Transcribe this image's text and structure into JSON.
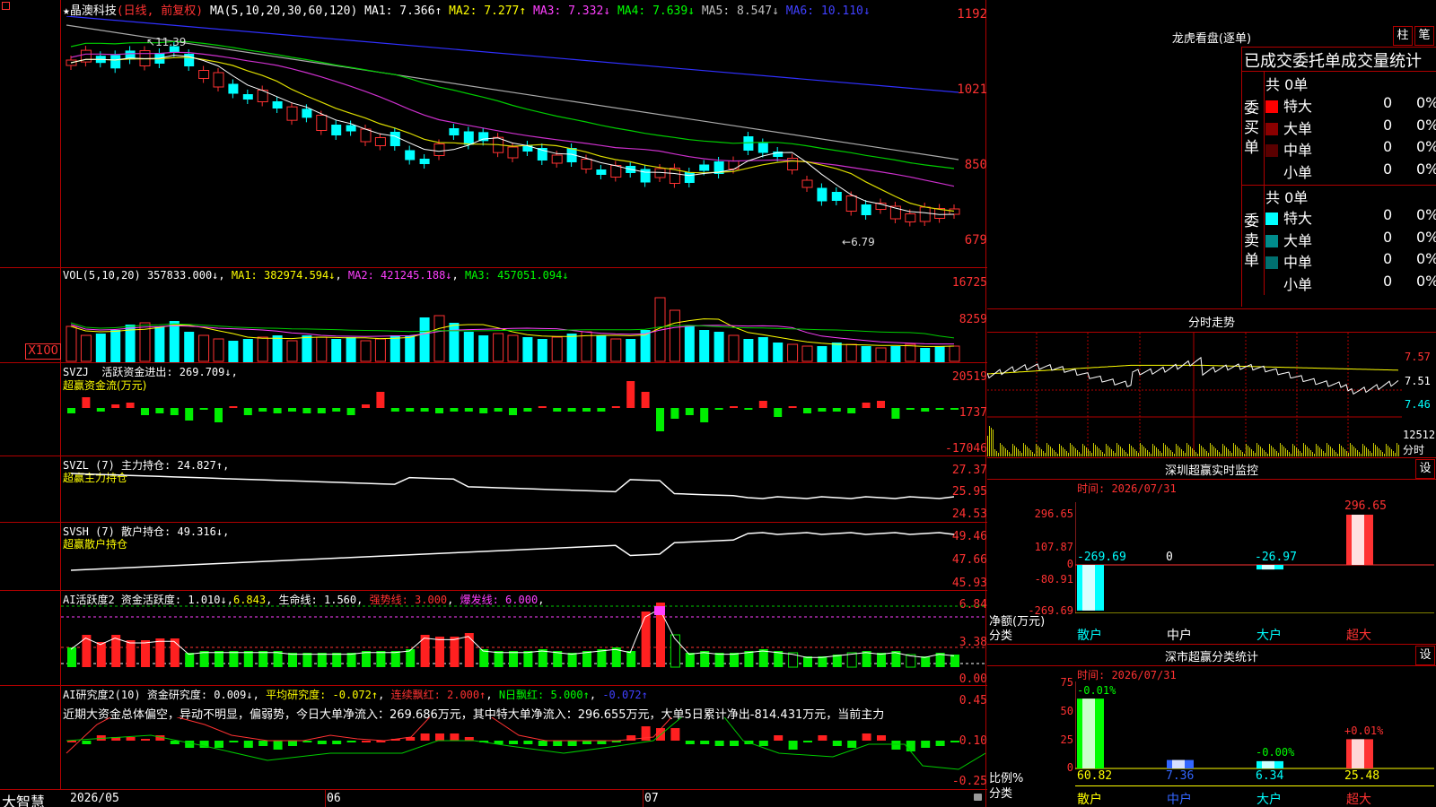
{
  "stock": {
    "title": "★晶澳科技",
    "mode": "(日线, 前复权)",
    "ma_label": "MA(5,10,20,30,60,120)",
    "ma": [
      {
        "label": "MA1: 7.366↑",
        "color": "#ffffff"
      },
      {
        "label": "MA2: 7.277↑",
        "color": "#ffff00"
      },
      {
        "label": "MA3: 7.332↓",
        "color": "#ff40ff"
      },
      {
        "label": "MA4: 7.639↓",
        "color": "#00ff00"
      },
      {
        "label": "MA5: 8.547↓",
        "color": "#c0c0c0"
      },
      {
        "label": "MA6: 10.110↓",
        "color": "#4040ff"
      }
    ],
    "y_ticks": [
      "1192",
      "1021",
      "850",
      "679"
    ],
    "high_mark": "11.39",
    "low_mark": "6.79"
  },
  "vol": {
    "label": "VOL(5,10,20)",
    "value": "357833.000↓",
    "ma1": "MA1: 382974.594↓",
    "ma2": "MA2: 421245.188↓",
    "ma3": "MA3: 457051.094↓",
    "y_ticks": [
      "16725",
      "8259",
      "X100"
    ]
  },
  "svzj": {
    "label": "SVZJ",
    "text": "活跃资金进出: 269.709↓",
    "sub": "超赢资金流(万元)",
    "y_ticks": [
      "20519",
      "1737",
      "-17046"
    ]
  },
  "svzl": {
    "label": "SVZL (7)",
    "text": "主力持仓: 24.827↑",
    "sub": "超赢主力持仓",
    "y_ticks": [
      "27.37",
      "25.95",
      "24.53"
    ]
  },
  "svsh": {
    "label": "SVSH (7)",
    "text": "散户持仓: 49.316↓",
    "sub": "超赢散户持仓",
    "y_ticks": [
      "49.46",
      "47.66",
      "45.93"
    ]
  },
  "ai2": {
    "label": "AI活跃度2",
    "t1": "资金活跃度: 1.010↓",
    "t2": "6.843",
    "t3": "生命线: 1.560",
    "t4": "强势线: 3.000",
    "t5": "爆发线: 6.000",
    "y_ticks": [
      "6.84",
      "3.38",
      "0.00"
    ]
  },
  "ai_res": {
    "label": "AI研究度2(10)",
    "t1": "资金研究度: 0.009↓",
    "t2": "平均研究度: -0.072↑",
    "t3": "连续飘红: 2.000↑",
    "t4": "N日飘红: 5.000↑",
    "t5": "-0.072↑",
    "desc": "近期大资金总体偏空，异动不明显，偏弱势，今日大单净流入：269.686万元，其中特大单净流入：296.655万元，大单5日累计净出-814.431万元，当前主力",
    "y_ticks": [
      "0.45",
      "0.10",
      "-0.25"
    ]
  },
  "footer": {
    "brand": "大智慧",
    "dates": [
      "2026/05",
      "06",
      "07"
    ]
  },
  "lhb": {
    "title": "龙虎看盘(逐单)",
    "btn_zhu": "柱",
    "btn_bi": "笔",
    "tabs": "已成交委托单成交量统计",
    "buy_side": "委买单",
    "sell_side": "委卖单",
    "buy_total": "共 0单",
    "sell_total": "共 0单",
    "buy_rows": [
      {
        "name": "特大",
        "count": "0",
        "pct": "0%",
        "color": "#ff0000"
      },
      {
        "name": "大单",
        "count": "0",
        "pct": "0%",
        "color": "#8b0000"
      },
      {
        "name": "中单",
        "count": "0",
        "pct": "0%",
        "color": "#5a0000"
      },
      {
        "name": "小单",
        "count": "0",
        "pct": "0%",
        "color": "#000000"
      }
    ],
    "sell_rows": [
      {
        "name": "特大",
        "count": "0",
        "pct": "0%",
        "color": "#00ffff"
      },
      {
        "name": "大单",
        "count": "0",
        "pct": "0%",
        "color": "#008b8b"
      },
      {
        "name": "中单",
        "count": "0",
        "pct": "0%",
        "color": "#007070"
      },
      {
        "name": "小单",
        "count": "0",
        "pct": "0%",
        "color": "#000000"
      }
    ]
  },
  "intraday": {
    "title": "分时走势",
    "y_ticks": [
      "7.57",
      "7.51",
      "7.46"
    ],
    "vol_label": "12512",
    "unit": "分时"
  },
  "sz_monitor": {
    "title": "深圳超赢实时监控",
    "set": "设",
    "time": "时间: 2026/07/31",
    "y_ticks": [
      "296.65",
      "107.87",
      "0",
      "-80.91",
      "-269.69"
    ],
    "values": [
      "-269.69",
      "0",
      "-26.97",
      "296.65"
    ],
    "axis_title1": "净额(万元)",
    "axis_title2": "分类",
    "cats": [
      "散户",
      "中户",
      "大户",
      "超大"
    ]
  },
  "sz_stats": {
    "title": "深市超赢分类统计",
    "set": "设",
    "time": "时间: 2026/07/31",
    "y_ticks": [
      "75",
      "50",
      "25",
      "0"
    ],
    "bar_values": [
      "60.82",
      "7.36",
      "6.34",
      "25.48"
    ],
    "changes": [
      "-0.01%",
      "-0.00%",
      "+0.01%"
    ],
    "axis_title1": "比例%",
    "axis_title2": "分类",
    "cats": [
      "散户",
      "中户",
      "大户",
      "超大"
    ]
  }
}
